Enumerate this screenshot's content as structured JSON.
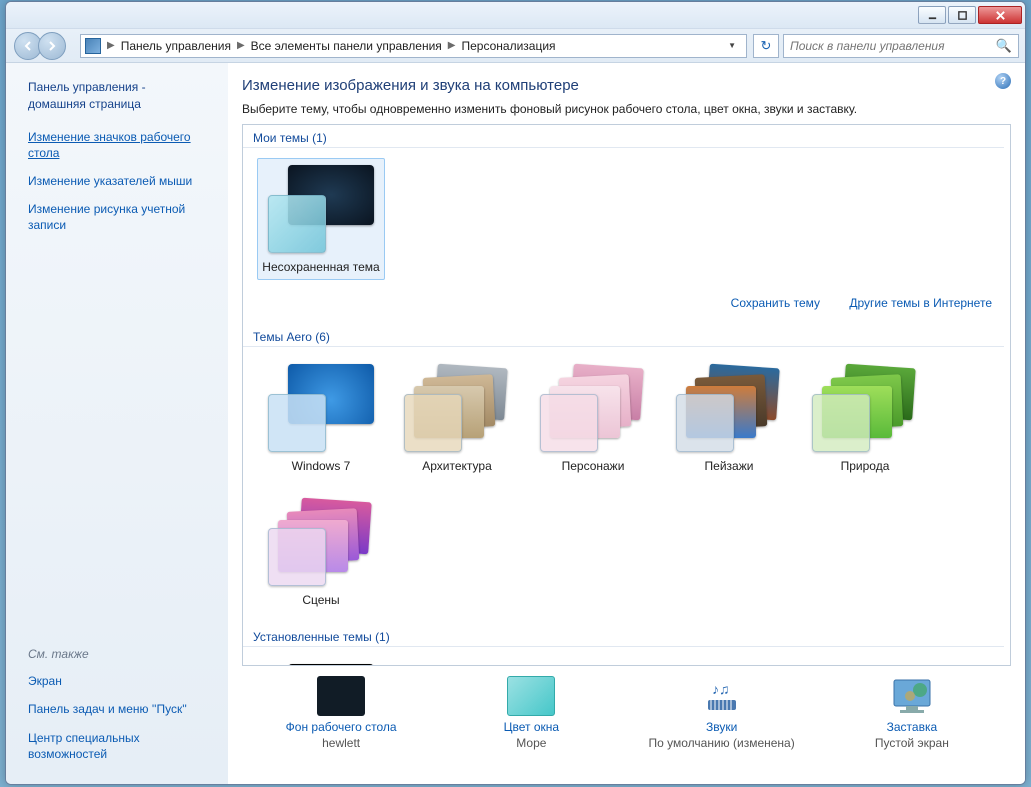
{
  "breadcrumb": {
    "p0": "Панель управления",
    "p1": "Все элементы панели управления",
    "p2": "Персонализация"
  },
  "search": {
    "placeholder": "Поиск в панели управления"
  },
  "sidebar": {
    "home1": "Панель управления -",
    "home2": "домашняя страница",
    "links": [
      "Изменение значков рабочего стола",
      "Изменение указателей мыши",
      "Изменение рисунка учетной записи"
    ],
    "see_also_hdr": "См. также",
    "see_also": [
      "Экран",
      "Панель задач и меню ''Пуск''",
      "Центр специальных возможностей"
    ]
  },
  "main": {
    "title": "Изменение изображения и звука на компьютере",
    "subtitle": "Выберите тему, чтобы одновременно изменить фоновый рисунок рабочего стола, цвет окна, звуки и заставку.",
    "group_my": "Мои темы (1)",
    "my_theme": "Несохраненная тема",
    "save_theme": "Сохранить тему",
    "more_online": "Другие темы в Интернете",
    "group_aero": "Темы Aero (6)",
    "aero": [
      "Windows 7",
      "Архитектура",
      "Персонажи",
      "Пейзажи",
      "Природа",
      "Сцены"
    ],
    "group_installed": "Установленные темы (1)"
  },
  "bottom": {
    "wall": {
      "title": "Фон рабочего стола",
      "val": "hewlett"
    },
    "color": {
      "title": "Цвет окна",
      "val": "Море"
    },
    "sound": {
      "title": "Звуки",
      "val": "По умолчанию (изменена)"
    },
    "saver": {
      "title": "Заставка",
      "val": "Пустой экран"
    }
  }
}
